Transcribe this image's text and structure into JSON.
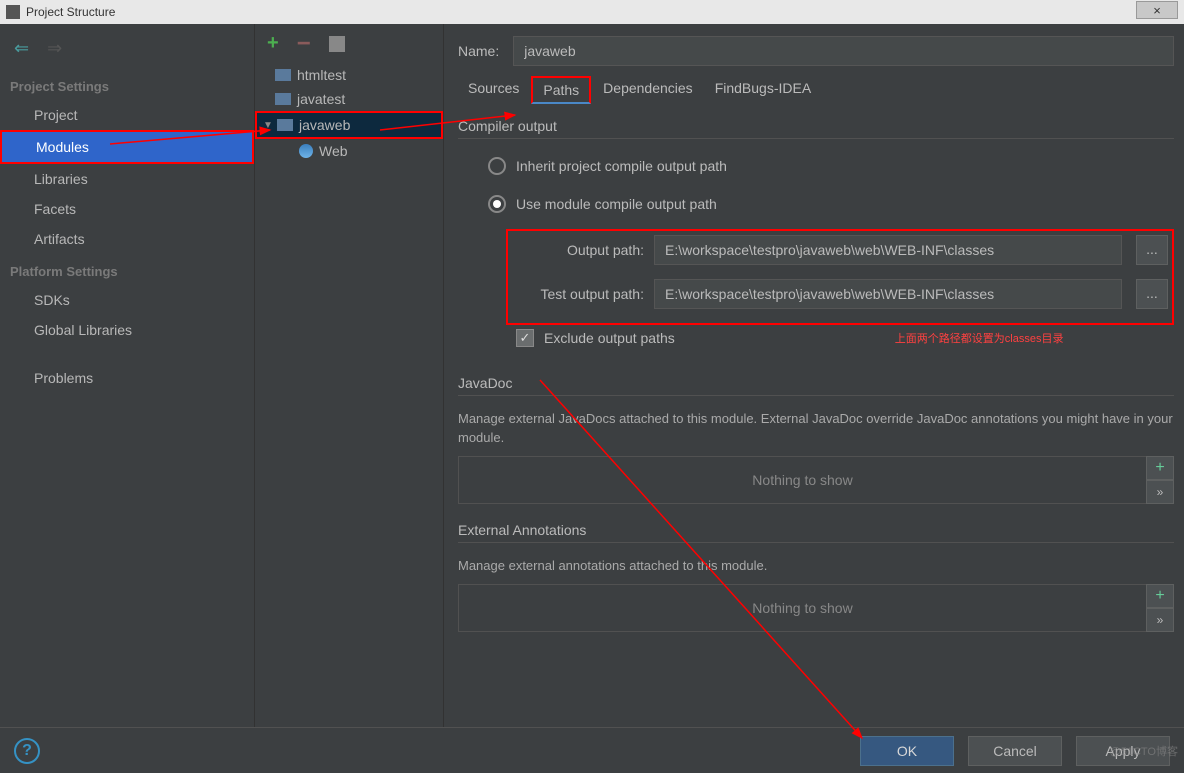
{
  "titlebar": {
    "title": "Project Structure",
    "close": "×"
  },
  "sidebar": {
    "sections": {
      "project": "Project Settings",
      "platform": "Platform Settings"
    },
    "items": {
      "project": "Project",
      "modules": "Modules",
      "libraries": "Libraries",
      "facets": "Facets",
      "artifacts": "Artifacts",
      "sdks": "SDKs",
      "global_libs": "Global Libraries",
      "problems": "Problems"
    }
  },
  "tree": {
    "items": [
      "htmltest",
      "javatest",
      "javaweb",
      "Web"
    ]
  },
  "content": {
    "name_label": "Name:",
    "name_value": "javaweb",
    "tabs": [
      "Sources",
      "Paths",
      "Dependencies",
      "FindBugs-IDEA"
    ],
    "compiler_output": "Compiler output",
    "radio_inherit": "Inherit project compile output path",
    "radio_module": "Use module compile output path",
    "output_path_label": "Output path:",
    "output_path_value": "E:\\workspace\\testpro\\javaweb\\web\\WEB-INF\\classes",
    "test_output_label": "Test output path:",
    "test_output_value": "E:\\workspace\\testpro\\javaweb\\web\\WEB-INF\\classes",
    "exclude_label": "Exclude output paths",
    "annotation_paths": "上面两个路径都设置为classes目录",
    "javadoc_head": "JavaDoc",
    "javadoc_desc": "Manage external JavaDocs attached to this module. External JavaDoc override JavaDoc annotations you might have in your module.",
    "ext_anno_head": "External Annotations",
    "ext_anno_desc": "Manage external annotations attached to this module.",
    "nothing": "Nothing to show",
    "browse": "..."
  },
  "footer": {
    "ok": "OK",
    "cancel": "Cancel",
    "apply": "Apply",
    "help": "?"
  },
  "watermark": "@51CTO博客"
}
